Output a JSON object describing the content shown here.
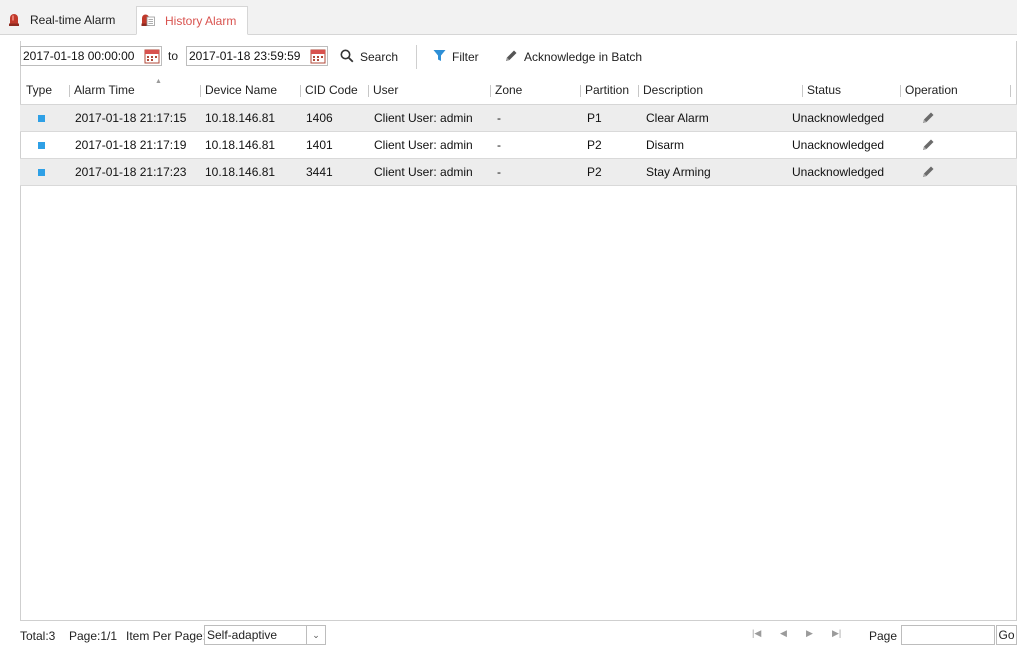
{
  "tabs": [
    {
      "label": "Real-time Alarm",
      "icon": "alarm-light-icon",
      "active": false
    },
    {
      "label": "History Alarm",
      "icon": "alarm-history-icon",
      "active": true,
      "color": "#d9534f"
    }
  ],
  "toolbar": {
    "start_time": "2017-01-18 00:00:00",
    "to_label": "to",
    "end_time": "2017-01-18 23:59:59",
    "search_label": "Search",
    "filter_label": "Filter",
    "ack_batch_label": "Acknowledge in Batch"
  },
  "table": {
    "columns": [
      "Type",
      "Alarm Time",
      "Device Name",
      "CID Code",
      "User",
      "Zone",
      "Partition",
      "Description",
      "Status",
      "Operation"
    ],
    "rows": [
      {
        "type_color": "#2ea0e6",
        "time": "2017-01-18 21:17:15",
        "device": "10.18.146.81",
        "cid": "1406",
        "user": "Client User: admin",
        "zone": "-",
        "partition": "P1",
        "description": "Clear Alarm",
        "status": "Unacknowledged"
      },
      {
        "type_color": "#2ea0e6",
        "time": "2017-01-18 21:17:19",
        "device": "10.18.146.81",
        "cid": "1401",
        "user": "Client User: admin",
        "zone": "-",
        "partition": "P2",
        "description": "Disarm",
        "status": "Unacknowledged"
      },
      {
        "type_color": "#2ea0e6",
        "time": "2017-01-18 21:17:23",
        "device": "10.18.146.81",
        "cid": "3441",
        "user": "Client User: admin",
        "zone": "-",
        "partition": "P2",
        "description": "Stay Arming",
        "status": "Unacknowledged"
      }
    ]
  },
  "footer": {
    "total": "Total:3",
    "page": "Page:1/1",
    "item_per_page_label": "Item Per Page:",
    "item_per_page_value": "Self-adaptive",
    "page_label": "Page",
    "go_label": "Go"
  }
}
